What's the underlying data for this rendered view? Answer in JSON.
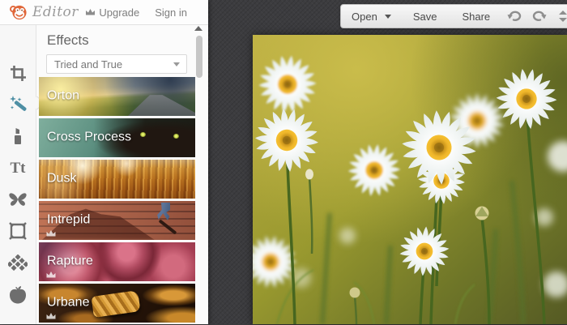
{
  "header": {
    "brand_title": "Editor",
    "brand_icon": "monkey-icon",
    "upgrade_label": "Upgrade",
    "signin_label": "Sign in"
  },
  "toolbar": {
    "open_label": "Open",
    "save_label": "Save",
    "share_label": "Share",
    "icons": [
      "undo-icon",
      "redo-icon",
      "collapse-icon"
    ]
  },
  "sidebar": {
    "text_tool_glyph": "Tt",
    "tools": [
      {
        "name": "crop",
        "icon": "crop-icon",
        "selected": false
      },
      {
        "name": "effects",
        "icon": "magic-wand-icon",
        "selected": true
      },
      {
        "name": "touch-up",
        "icon": "lipstick-icon",
        "selected": false
      },
      {
        "name": "text",
        "icon": "text-icon",
        "selected": false
      },
      {
        "name": "overlays",
        "icon": "butterfly-icon",
        "selected": false
      },
      {
        "name": "frames",
        "icon": "frame-icon",
        "selected": false
      },
      {
        "name": "textures",
        "icon": "lattice-icon",
        "selected": false
      },
      {
        "name": "themes",
        "icon": "apple-icon",
        "selected": false
      }
    ]
  },
  "effects_panel": {
    "title": "Effects",
    "category_dropdown_value": "Tried and True",
    "effects": [
      {
        "label": "Orton",
        "premium": false
      },
      {
        "label": "Cross Process",
        "premium": false
      },
      {
        "label": "Dusk",
        "premium": false
      },
      {
        "label": "Intrepid",
        "premium": true
      },
      {
        "label": "Rapture",
        "premium": true
      },
      {
        "label": "Urbane",
        "premium": true
      }
    ]
  },
  "canvas": {
    "image_description": "Close-up photo of white oxeye daisies with yellow-orange centers and green stems against a blurred yellow-green meadow background"
  },
  "colors": {
    "accent_teal": "#4e8fa4",
    "brand_orange": "#e0673a",
    "workspace_bg": "#3b3b3e",
    "panel_bg": "#fbfbfb"
  }
}
